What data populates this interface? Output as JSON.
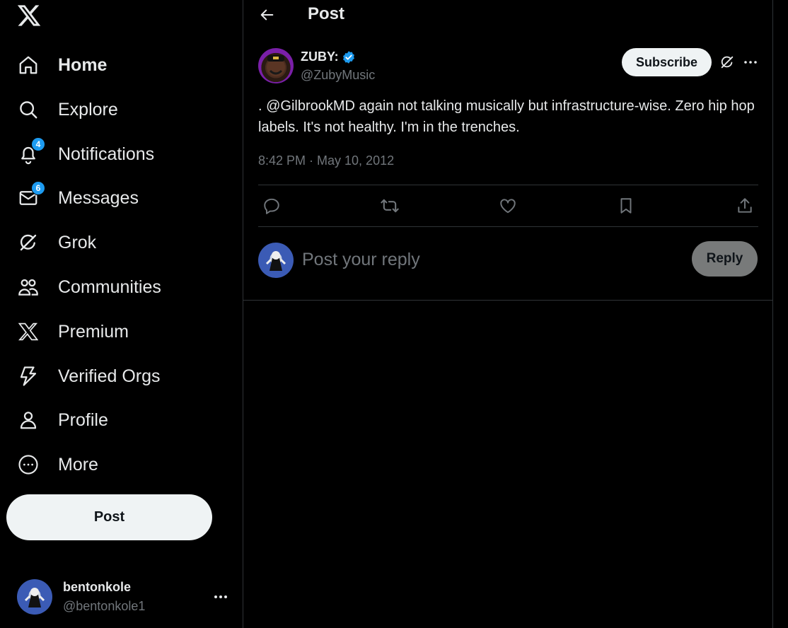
{
  "sidebar": {
    "logo_icon": "x-logo-icon",
    "nav": [
      {
        "label": "Home",
        "icon": "home-icon",
        "badge": null
      },
      {
        "label": "Explore",
        "icon": "search-icon",
        "badge": null
      },
      {
        "label": "Notifications",
        "icon": "bell-icon",
        "badge": "4"
      },
      {
        "label": "Messages",
        "icon": "envelope-icon",
        "badge": "6"
      },
      {
        "label": "Grok",
        "icon": "grok-icon",
        "badge": null
      },
      {
        "label": "Communities",
        "icon": "people-icon",
        "badge": null
      },
      {
        "label": "Premium",
        "icon": "x-logo-icon",
        "badge": null
      },
      {
        "label": "Verified Orgs",
        "icon": "lightning-icon",
        "badge": null
      },
      {
        "label": "Profile",
        "icon": "person-icon",
        "badge": null
      },
      {
        "label": "More",
        "icon": "more-circle-icon",
        "badge": null
      }
    ],
    "post_button_label": "Post",
    "account": {
      "name": "bentonkole",
      "handle": "@bentonkole1"
    }
  },
  "header": {
    "title": "Post"
  },
  "tweet": {
    "author_name": "ZUBY:",
    "author_handle": "@ZubyMusic",
    "verified": true,
    "subscribe_label": "Subscribe",
    "text": ". @GilbrookMD again not talking musically but infrastructure-wise. Zero hip hop labels. It's not healthy. I'm in the trenches.",
    "timestamp": "8:42 PM · May 10, 2012",
    "actions": [
      "reply-icon",
      "retweet-icon",
      "like-icon",
      "bookmark-icon",
      "share-icon"
    ]
  },
  "reply": {
    "placeholder": "Post your reply",
    "button_label": "Reply"
  },
  "colors": {
    "accent": "#1d9bf0",
    "background": "#000000",
    "text": "#e7e9ea",
    "muted": "#71767b",
    "border": "#2f3336"
  }
}
